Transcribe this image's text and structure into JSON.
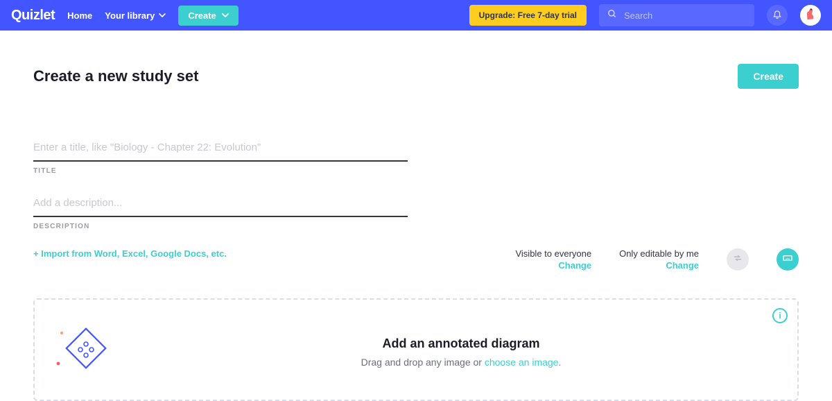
{
  "nav": {
    "logo": "Quizlet",
    "home": "Home",
    "library": "Your library",
    "create": "Create",
    "upgrade": "Upgrade: Free 7-day trial",
    "search_placeholder": "Search"
  },
  "page": {
    "title": "Create a new study set",
    "create_button": "Create"
  },
  "form": {
    "title_placeholder": "Enter a title, like \"Biology - Chapter 22: Evolution\"",
    "title_label": "TITLE",
    "title_value": "",
    "description_placeholder": "Add a description...",
    "description_label": "DESCRIPTION",
    "description_value": "",
    "import_link": "+ Import from Word, Excel, Google Docs, etc."
  },
  "permissions": {
    "visible_label": "Visible to everyone",
    "editable_label": "Only editable by me",
    "change": "Change"
  },
  "dropzone": {
    "title": "Add an annotated diagram",
    "sub_prefix": "Drag and drop any image or ",
    "choose_link": "choose an image",
    "sub_suffix": ".",
    "info": "i"
  }
}
